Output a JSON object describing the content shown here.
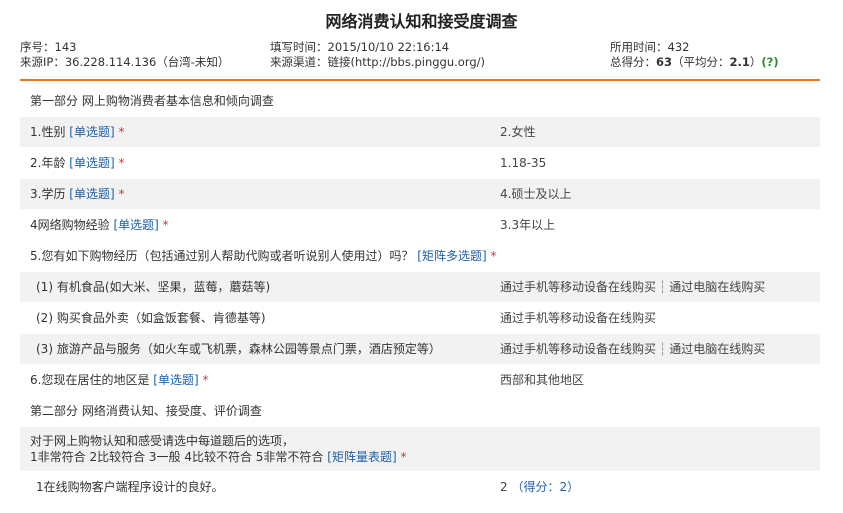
{
  "title": "网络消费认知和接受度调查",
  "meta": {
    "serial_label": "序号：",
    "serial_value": "143",
    "fill_time_label": "填写时间：",
    "fill_time_value": "2015/10/10 22:16:14",
    "duration_label": "所用时间：",
    "duration_value": "432",
    "source_ip_label": "来源IP：",
    "source_ip_value": "36.228.114.136（台湾-未知）",
    "channel_label": "来源渠道：",
    "channel_value": "链接(http://bbs.pinggu.org/)",
    "total_score_label": "总得分：",
    "total_score_value": "63",
    "avg_prefix": "（平均分：",
    "avg_value": "2.1",
    "avg_suffix": "）",
    "help_mark": "(?)"
  },
  "sections": {
    "part1": "第一部分 网上购物消费者基本信息和倾向调查",
    "part2": "第二部分 网络消费认知、接受度、评价调查"
  },
  "questions": {
    "q1": {
      "text": "1.性别",
      "tag": "[单选题]",
      "req": "*",
      "answer": "2.女性"
    },
    "q2": {
      "text": "2.年龄",
      "tag": "[单选题]",
      "req": "*",
      "answer": "1.18-35"
    },
    "q3": {
      "text": "3.学历",
      "tag": "[单选题]",
      "req": "*",
      "answer": "4.硕士及以上"
    },
    "q4": {
      "text": "4网络购物经验",
      "tag": "[单选题]",
      "req": "*",
      "answer": "3.3年以上"
    },
    "q5": {
      "text": "5.您有如下购物经历（包括通过别人帮助代购或者听说别人使用过）吗？",
      "tag": "[矩阵多选题]",
      "req": "*"
    },
    "q5_items": [
      {
        "text": "(1) 有机食品(如大米、坚果，蓝莓，蘑菇等)",
        "answer_a": "通过手机等移动设备在线购买",
        "sep": "┆",
        "answer_b": "通过电脑在线购买"
      },
      {
        "text": "(2) 购买食品外卖（如盒饭套餐、肯德基等)",
        "answer_a": "通过手机等移动设备在线购买",
        "sep": "",
        "answer_b": ""
      },
      {
        "text": "(3) 旅游产品与服务（如火车或飞机票，森林公园等景点门票，酒店预定等）",
        "answer_a": "通过手机等移动设备在线购买",
        "sep": "┆",
        "answer_b": "通过电脑在线购买"
      }
    ],
    "q6": {
      "text": "6.您现在居住的地区是",
      "tag": "[单选题]",
      "req": "*",
      "answer": "西部和其他地区"
    },
    "matrix_intro_line1": "对于网上购物认知和感受请选中每道题后的选项，",
    "matrix_intro_line2": "1非常符合 2比较符合 3一般 4比较不符合 5非常不符合",
    "matrix_tag": "[矩阵量表题]",
    "matrix_req": "*",
    "m1": {
      "text": "1在线购物客户端程序设计的良好。",
      "answer": "2",
      "score": "（得分：2）"
    }
  }
}
